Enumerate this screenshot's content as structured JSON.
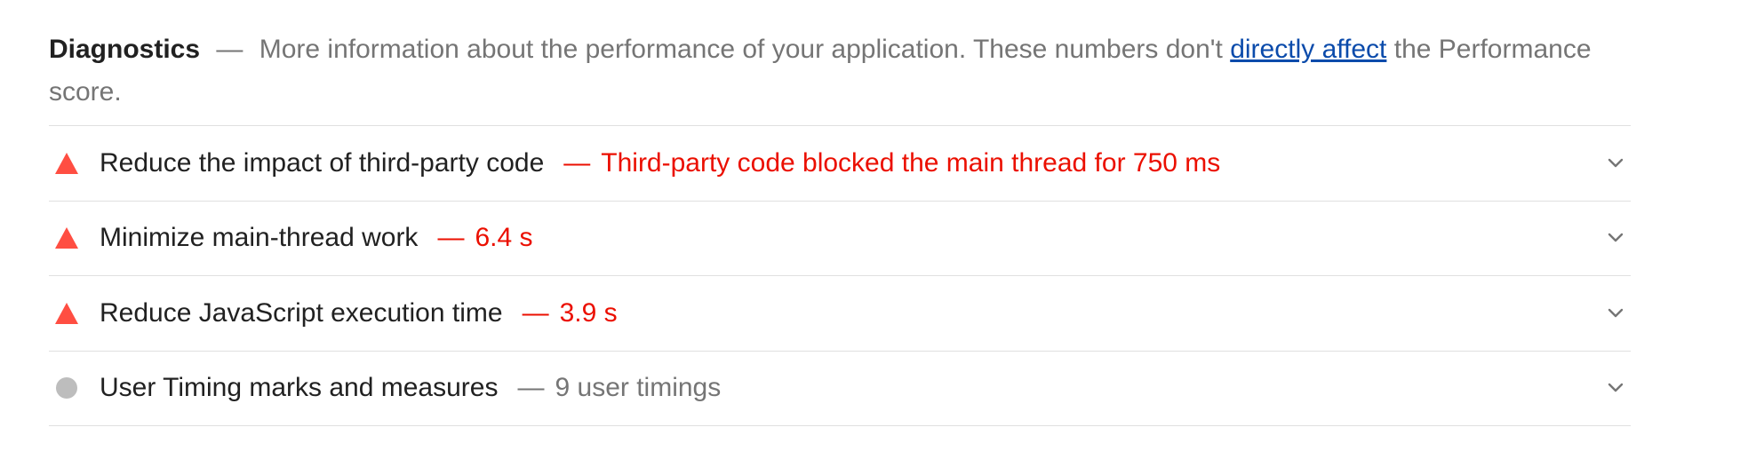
{
  "section": {
    "title": "Diagnostics",
    "dash": "—",
    "desc_before": "More information about the performance of your application. These numbers don't",
    "link_text": "directly affect",
    "desc_after": "the Performance score."
  },
  "audits": [
    {
      "status": "fail",
      "icon": "warning-triangle-icon",
      "title": "Reduce the impact of third-party code",
      "dash": "—",
      "value": "Third-party code blocked the main thread for 750 ms"
    },
    {
      "status": "fail",
      "icon": "warning-triangle-icon",
      "title": "Minimize main-thread work",
      "dash": "—",
      "value": "6.4 s"
    },
    {
      "status": "fail",
      "icon": "warning-triangle-icon",
      "title": "Reduce JavaScript execution time",
      "dash": "—",
      "value": "3.9 s"
    },
    {
      "status": "informative",
      "icon": "info-circle-icon",
      "title": "User Timing marks and measures",
      "dash": "—",
      "value": "9 user timings"
    }
  ],
  "colors": {
    "fail": "#eb0f00",
    "fail_icon": "#ff4e42",
    "informative": "#757575",
    "informative_icon": "#bdbdbd",
    "link": "#0b4bab"
  }
}
